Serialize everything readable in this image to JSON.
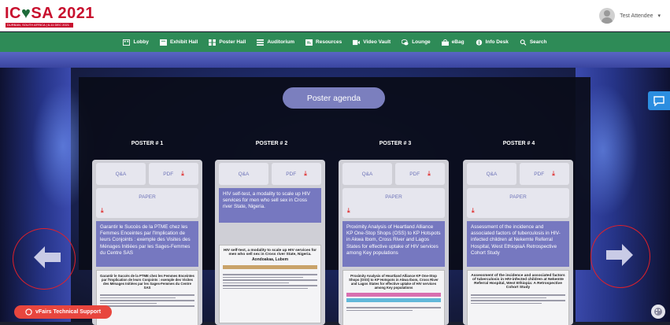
{
  "header": {
    "logo_text": "IC",
    "logo_mid": "SA",
    "logo_year": "2021",
    "logo_sub": "DURBAN, SOUTH AFRICA | 6-11 DEC 2021",
    "user_name": "Test Attendee",
    "user_caret": "▾"
  },
  "nav": {
    "items": [
      {
        "label": "Lobby",
        "icon": "lobby-icon"
      },
      {
        "label": "Exhibit Hall",
        "icon": "exhibit-icon"
      },
      {
        "label": "Poster Hall",
        "icon": "poster-icon"
      },
      {
        "label": "Auditorium",
        "icon": "auditorium-icon"
      },
      {
        "label": "Resources",
        "icon": "resources-icon"
      },
      {
        "label": "Video Vault",
        "icon": "video-icon"
      },
      {
        "label": "Lounge",
        "icon": "lounge-icon"
      },
      {
        "label": "eBag",
        "icon": "bag-icon"
      },
      {
        "label": "Info Desk",
        "icon": "info-icon"
      },
      {
        "label": "Search",
        "icon": "search-icon"
      }
    ]
  },
  "agenda_label": "Poster agenda",
  "posters": [
    {
      "label": "POSTER # 1",
      "qa": "Q&A",
      "pdf": "PDF",
      "paper": "PAPER",
      "description": "Garantir le Succès de la PTME chez les Femmes Enceintes par l'Implication de leurs Conjoints : exemple des Visites des Ménages Initiées par les Sages-Femmes du Centre SAS"
    },
    {
      "label": "POSTER # 2",
      "qa": "Q&A",
      "pdf": "PDF",
      "paper": "",
      "description": "HIV self-test, a modality to scale up HIV services for men who sell sex in Cross river State, Nigeria."
    },
    {
      "label": "POSTER # 3",
      "qa": "Q&A",
      "pdf": "PDF",
      "paper": "PAPER",
      "description": "Proximity Analysis of Heartland Alliance KP One-Stop Shops (OSS) to KP Hotspots in Akwa Ibom, Cross River and Lagos States for effective uptake of HIV services among Key populations"
    },
    {
      "label": "POSTER # 4",
      "qa": "Q&A",
      "pdf": "PDF",
      "paper": "PAPER",
      "description": "Assessment of the incidence and associated factors of tuberculosis in HIV-infected children at Nekemte Referral Hospital, West EthiopiaA Retrospective Cohort Study"
    }
  ],
  "thumbs": {
    "p1": "Garantir le Succès de la PTME chez les Femmes Enceintes par l'Implication de leurs Conjoints : exemple des Visites des Ménages Initiées par les Sages-Femmes du Centre SAS",
    "p2": "HIV self-test, a modality to scale up HIV services for men who sell sex in Cross river State, Nigeria.",
    "p2_author": "Aondoakaa, Lubem",
    "p3": "Proximity Analysis of Heartland Alliance KP One-Stop Shops (OSS) to KP Hotspots in Akwa Ibom, Cross River and Lagos States for effective uptake of HIV services among Key populations",
    "p4": "Assessment of the incidence and associated factors of tuberculosis in HIV-infected children at Nekemte Referral Hospital, West Ethiopia: A Retrospective Cohort Study"
  },
  "support_label": "vFairs Technical Support",
  "colors": {
    "nav_bg": "#2e8b57",
    "brand_red": "#c8102e",
    "card_desc": "#7678c0",
    "agenda_btn": "#7b7fbe",
    "support_btn": "#e8463e",
    "chat_btn": "#2c8ee0"
  }
}
